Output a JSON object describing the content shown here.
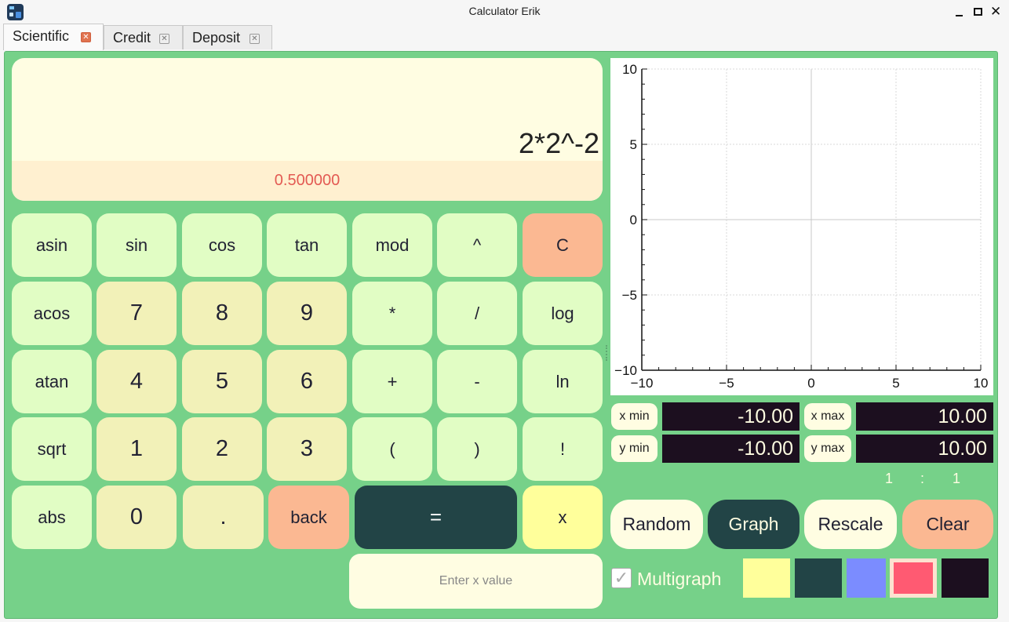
{
  "window": {
    "title": "Calculator Erik",
    "close_glyph": "✕"
  },
  "tabs": [
    {
      "label": "Scientific",
      "active": true
    },
    {
      "label": "Credit",
      "active": false
    },
    {
      "label": "Deposit",
      "active": false
    }
  ],
  "tab_close_glyph": "✕",
  "display": {
    "expression": "2*2^-2",
    "result": "0.500000"
  },
  "keys": {
    "asin": "asin",
    "sin": "sin",
    "cos": "cos",
    "tan": "tan",
    "mod": "mod",
    "pow": "^",
    "clear": "C",
    "acos": "acos",
    "n7": "7",
    "n8": "8",
    "n9": "9",
    "mul": "*",
    "div": "/",
    "log": "log",
    "atan": "atan",
    "n4": "4",
    "n5": "5",
    "n6": "6",
    "plus": "+",
    "minus": "-",
    "ln": "ln",
    "sqrt": "sqrt",
    "n1": "1",
    "n2": "2",
    "n3": "3",
    "lparen": "(",
    "rparen": ")",
    "fact": "!",
    "abs": "abs",
    "n0": "0",
    "dot": ".",
    "back": "back",
    "equals": "=",
    "x": "x"
  },
  "x_input": {
    "placeholder": "Enter x value",
    "value": ""
  },
  "chart_data": {
    "type": "line",
    "title": "",
    "xlabel": "",
    "ylabel": "",
    "xlim": [
      -10,
      10
    ],
    "ylim": [
      -10,
      10
    ],
    "x_ticks": [
      "−10",
      "−5",
      "0",
      "5",
      "10"
    ],
    "y_ticks": [
      "10",
      "5",
      "0",
      "−5",
      "−10"
    ],
    "grid": true,
    "series": []
  },
  "range": {
    "x_min_label": "x min",
    "x_min_value": "-10.00",
    "x_max_label": "x max",
    "x_max_value": "10.00",
    "y_min_label": "y min",
    "y_min_value": "-10.00",
    "y_max_label": "y max",
    "y_max_value": "10.00"
  },
  "ratio": {
    "left": "1",
    "sep": ":",
    "right": "1"
  },
  "buttons": {
    "random": "Random",
    "graph": "Graph",
    "rescale": "Rescale",
    "clear": "Clear"
  },
  "multigraph": {
    "label": "Multigraph",
    "checked": true,
    "check_glyph": "✓"
  },
  "colors": {
    "background": "#76d189",
    "swatches": [
      "#ffff9b",
      "#224446",
      "#7b8cff",
      "#ff5a72",
      "#1c0f1f"
    ]
  }
}
